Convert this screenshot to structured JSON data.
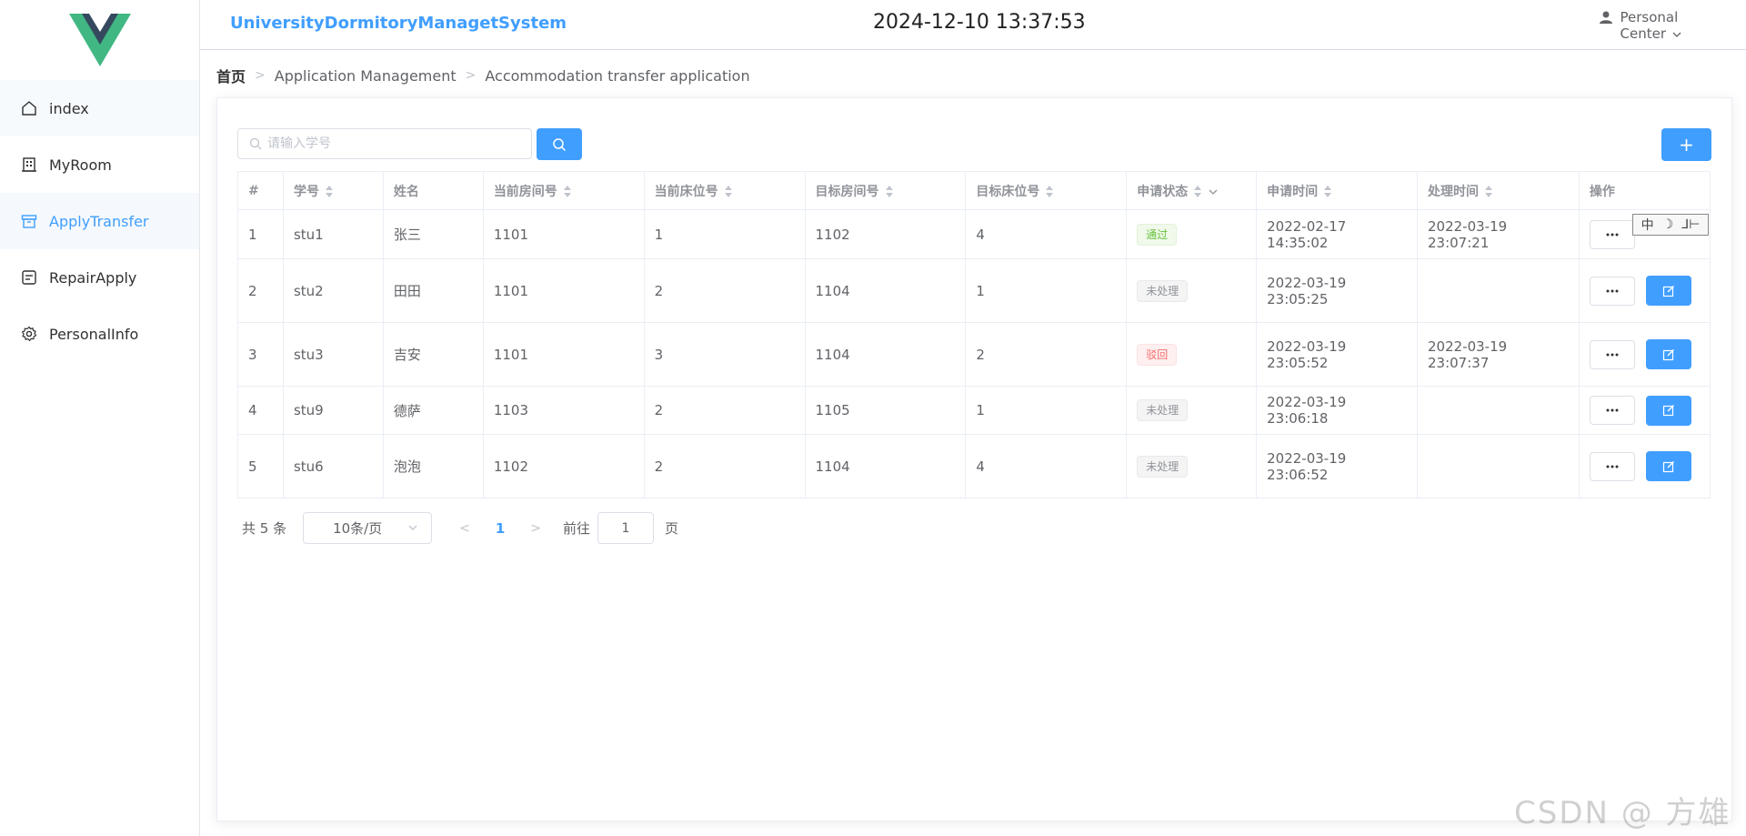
{
  "app": {
    "title": "UniversityDormitoryManagetSystem",
    "clock": "2024-12-10 13:37:53",
    "user_label_line1": "Personal",
    "user_label_line2": "Center"
  },
  "sidebar": {
    "items": [
      {
        "label": "index",
        "icon": "home-icon"
      },
      {
        "label": "MyRoom",
        "icon": "building-icon"
      },
      {
        "label": "ApplyTransfer",
        "icon": "box-icon"
      },
      {
        "label": "RepairApply",
        "icon": "repair-icon"
      },
      {
        "label": "PersonalInfo",
        "icon": "gear-icon"
      }
    ],
    "active_index": 2
  },
  "breadcrumb": {
    "home": "首页",
    "level1": "Application Management",
    "level2": "Accommodation transfer application"
  },
  "search": {
    "placeholder": "请输入学号",
    "value": ""
  },
  "toolbar": {
    "add_label": "+"
  },
  "table": {
    "columns": [
      "#",
      "学号",
      "姓名",
      "当前房间号",
      "当前床位号",
      "目标房间号",
      "目标床位号",
      "申请状态",
      "申请时间",
      "处理时间",
      "操作"
    ],
    "rows": [
      {
        "no": "1",
        "student_id": "stu1",
        "name": "张三",
        "cur_room": "1101",
        "cur_bed": "1",
        "target_room": "1102",
        "target_bed": "4",
        "status": "通过",
        "status_type": "success",
        "apply_time": "2022-02-17 14:35:02",
        "process_time": "2022-03-19 23:07:21"
      },
      {
        "no": "2",
        "student_id": "stu2",
        "name": "田田",
        "cur_room": "1101",
        "cur_bed": "2",
        "target_room": "1104",
        "target_bed": "1",
        "status": "未处理",
        "status_type": "info",
        "apply_time": "2022-03-19 23:05:25",
        "process_time": ""
      },
      {
        "no": "3",
        "student_id": "stu3",
        "name": "吉安",
        "cur_room": "1101",
        "cur_bed": "3",
        "target_room": "1104",
        "target_bed": "2",
        "status": "驳回",
        "status_type": "danger",
        "apply_time": "2022-03-19 23:05:52",
        "process_time": "2022-03-19 23:07:37"
      },
      {
        "no": "4",
        "student_id": "stu9",
        "name": "德萨",
        "cur_room": "1103",
        "cur_bed": "2",
        "target_room": "1105",
        "target_bed": "1",
        "status": "未处理",
        "status_type": "info",
        "apply_time": "2022-03-19 23:06:18",
        "process_time": ""
      },
      {
        "no": "5",
        "student_id": "stu6",
        "name": "泡泡",
        "cur_room": "1102",
        "cur_bed": "2",
        "target_room": "1104",
        "target_bed": "4",
        "status": "未处理",
        "status_type": "info",
        "apply_time": "2022-03-19 23:06:52",
        "process_time": ""
      }
    ]
  },
  "ime_bar": {
    "items": [
      "中",
      "☽",
      "⅃⊢"
    ]
  },
  "pagination": {
    "total": "共 5 条",
    "page_size": "10条/页",
    "current": "1",
    "goto_label": "前往",
    "goto_value": "1",
    "goto_unit": "页"
  },
  "watermark": "CSDN @   方雄",
  "colors": {
    "primary": "#409eff",
    "success": "#67c23a",
    "danger": "#f56c6c",
    "info": "#909399",
    "logo_green": "#41b883",
    "logo_dark": "#35495e"
  }
}
